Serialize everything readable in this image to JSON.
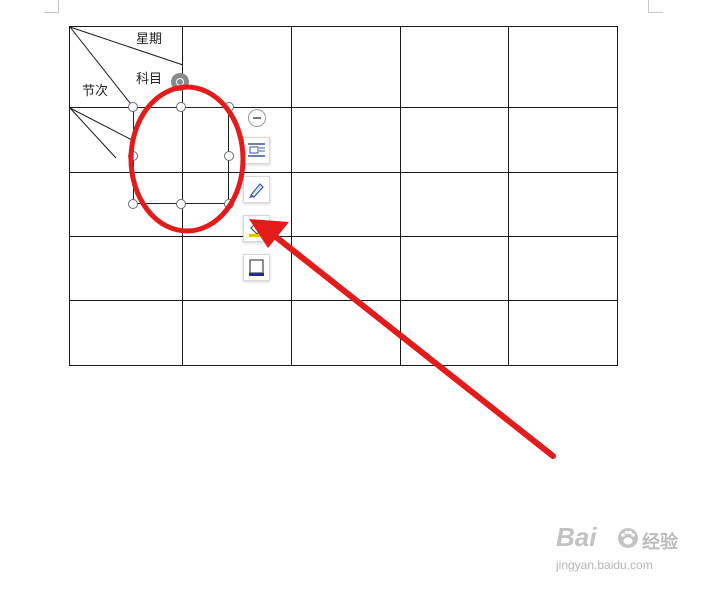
{
  "table": {
    "header": {
      "week_label": "星期",
      "subject_label": "科目",
      "period_label": "节次"
    },
    "rows": 5,
    "cols": 5
  },
  "toolbar": {
    "buttons": [
      {
        "icon": "layout-options-icon"
      },
      {
        "icon": "shape-style-pen-icon"
      },
      {
        "icon": "fill-bucket-icon"
      },
      {
        "icon": "border-outline-icon"
      }
    ]
  },
  "annotation": {
    "color": "#e31b1b"
  },
  "watermark": {
    "brand": "Bai",
    "brand_tail": "du",
    "product": "经验",
    "url": "jingyan.baidu.com"
  }
}
